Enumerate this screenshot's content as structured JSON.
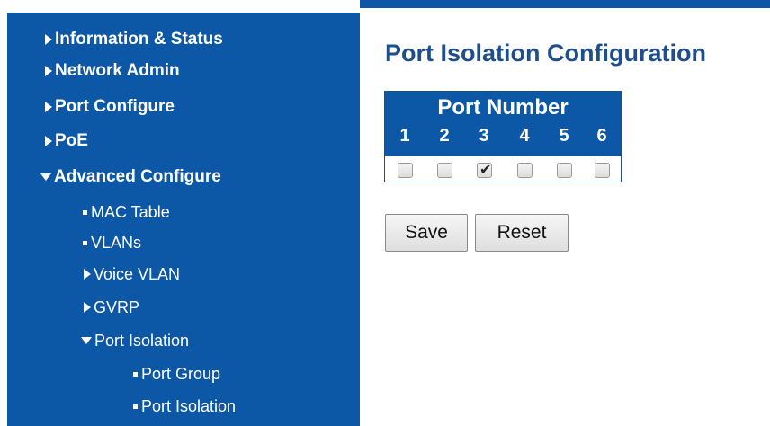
{
  "sidebar": {
    "items": [
      {
        "label": "Information & Status",
        "marker": "caret-right"
      },
      {
        "label": "Network Admin",
        "marker": "caret-right"
      },
      {
        "label": "Port Configure",
        "marker": "caret-right"
      },
      {
        "label": "PoE",
        "marker": "caret-right"
      },
      {
        "label": "Advanced Configure",
        "marker": "caret-down"
      },
      {
        "label": "MAC Table",
        "marker": "bullet"
      },
      {
        "label": "VLANs",
        "marker": "bullet"
      },
      {
        "label": "Voice VLAN",
        "marker": "caret-right"
      },
      {
        "label": "GVRP",
        "marker": "caret-right"
      },
      {
        "label": "Port Isolation",
        "marker": "caret-down"
      },
      {
        "label": "Port Group",
        "marker": "bullet"
      },
      {
        "label": "Port Isolation",
        "marker": "bullet"
      }
    ]
  },
  "main": {
    "title": "Port Isolation Configuration",
    "port_table": {
      "header": "Port Number",
      "ports": [
        {
          "number": "1",
          "checked": false
        },
        {
          "number": "2",
          "checked": false
        },
        {
          "number": "3",
          "checked": true
        },
        {
          "number": "4",
          "checked": false
        },
        {
          "number": "5",
          "checked": false
        },
        {
          "number": "6",
          "checked": false
        }
      ]
    },
    "buttons": {
      "save": "Save",
      "reset": "Reset"
    }
  },
  "colors": {
    "sidebar_bg": "#0d57a7",
    "title": "#1e4e8c"
  },
  "icons": {
    "caret_right": "caret-right-icon",
    "caret_down": "caret-down-icon",
    "bullet": "bullet-icon",
    "check": "check-icon"
  }
}
